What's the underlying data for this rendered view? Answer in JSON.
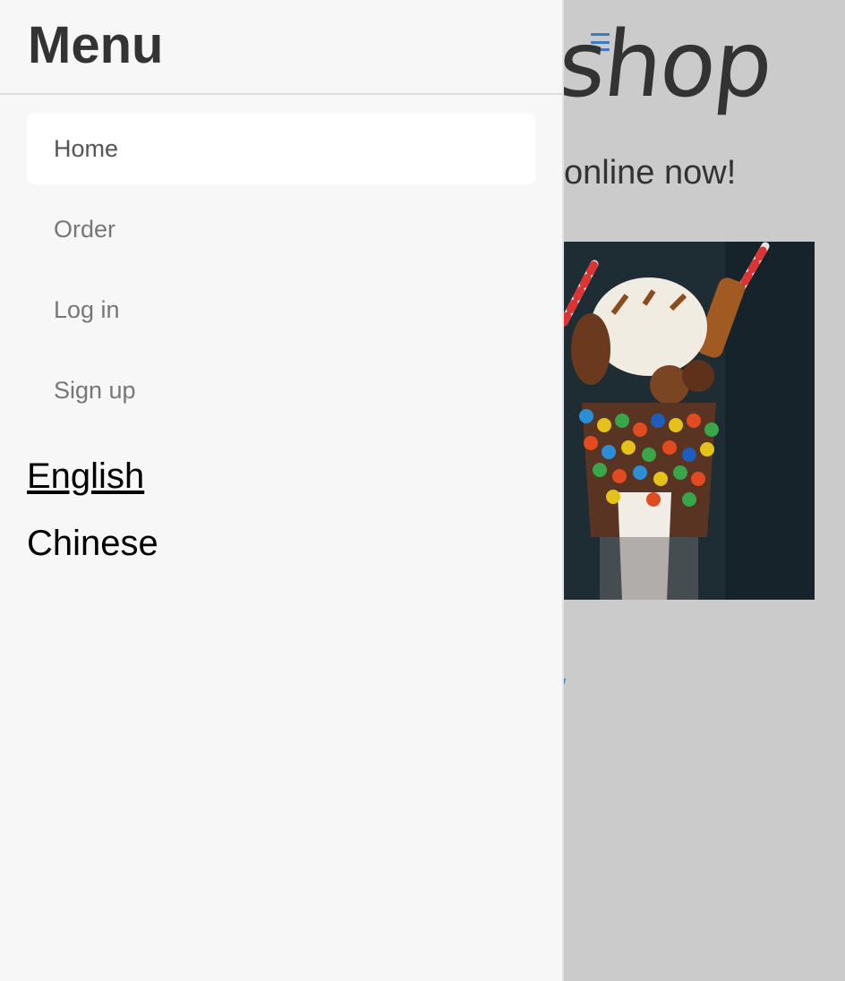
{
  "page": {
    "logo_text": "shop",
    "tagline": "online now!",
    "stray_link_text": "/"
  },
  "menu": {
    "title": "Menu",
    "items": [
      {
        "label": "Home",
        "active": true
      },
      {
        "label": "Order",
        "active": false
      },
      {
        "label": "Log in",
        "active": false
      },
      {
        "label": "Sign up",
        "active": false
      }
    ],
    "languages": [
      {
        "label": "English",
        "current": true
      },
      {
        "label": "Chinese",
        "current": false
      }
    ]
  },
  "icons": {
    "hamburger": "hamburger-menu-icon"
  },
  "colors": {
    "accent": "#3b7bc3",
    "drawer_bg": "#f7f7f7",
    "backdrop": "#cbcbcb",
    "active_item_bg": "#ffffff"
  },
  "image": {
    "subject": "milkshake-photo"
  }
}
